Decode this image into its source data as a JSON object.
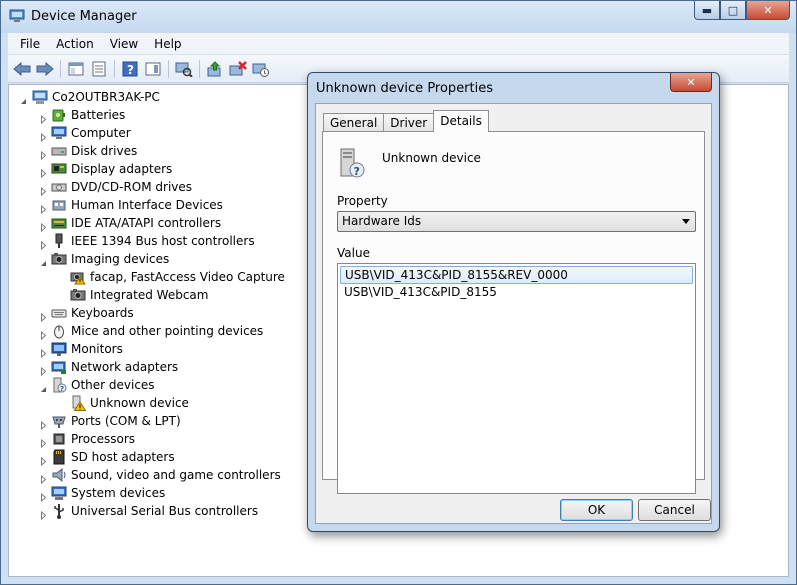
{
  "window": {
    "title": "Device Manager",
    "caption_min": "▬",
    "caption_max": "□",
    "caption_close": "✕"
  },
  "menu": [
    "File",
    "Action",
    "View",
    "Help"
  ],
  "toolbar": {
    "icons": [
      "back-arrow-icon",
      "forward-arrow-icon",
      "console-tree-icon",
      "properties-icon",
      "help-icon",
      "action-pane-icon",
      "scan-hardware-icon",
      "update-driver-icon",
      "uninstall-icon",
      "disable-icon"
    ]
  },
  "tree": {
    "root": "Co2OUTBR3AK-PC",
    "categories": [
      {
        "label": "Batteries",
        "icon": "battery-icon",
        "expanded": false
      },
      {
        "label": "Computer",
        "icon": "computer-icon",
        "expanded": false
      },
      {
        "label": "Disk drives",
        "icon": "disk-drive-icon",
        "expanded": false
      },
      {
        "label": "Display adapters",
        "icon": "display-adapter-icon",
        "expanded": false
      },
      {
        "label": "DVD/CD-ROM drives",
        "icon": "dvd-drive-icon",
        "expanded": false
      },
      {
        "label": "Human Interface Devices",
        "icon": "hid-icon",
        "expanded": false
      },
      {
        "label": "IDE ATA/ATAPI controllers",
        "icon": "ide-controller-icon",
        "expanded": false
      },
      {
        "label": "IEEE 1394 Bus host controllers",
        "icon": "firewire-icon",
        "expanded": false
      },
      {
        "label": "Imaging devices",
        "icon": "camera-icon",
        "expanded": true,
        "children": [
          {
            "label": "facap, FastAccess Video Capture",
            "icon": "camera-warning-icon"
          },
          {
            "label": "Integrated Webcam",
            "icon": "camera-icon"
          }
        ]
      },
      {
        "label": "Keyboards",
        "icon": "keyboard-icon",
        "expanded": false
      },
      {
        "label": "Mice and other pointing devices",
        "icon": "mouse-icon",
        "expanded": false
      },
      {
        "label": "Monitors",
        "icon": "monitor-icon",
        "expanded": false
      },
      {
        "label": "Network adapters",
        "icon": "network-adapter-icon",
        "expanded": false
      },
      {
        "label": "Other devices",
        "icon": "unknown-device-icon",
        "expanded": true,
        "children": [
          {
            "label": "Unknown device",
            "icon": "warning-device-icon"
          }
        ]
      },
      {
        "label": "Ports (COM & LPT)",
        "icon": "port-icon",
        "expanded": false
      },
      {
        "label": "Processors",
        "icon": "processor-icon",
        "expanded": false
      },
      {
        "label": "SD host adapters",
        "icon": "sd-card-icon",
        "expanded": false
      },
      {
        "label": "Sound, video and game controllers",
        "icon": "speaker-icon",
        "expanded": false
      },
      {
        "label": "System devices",
        "icon": "system-device-icon",
        "expanded": false
      },
      {
        "label": "Universal Serial Bus controllers",
        "icon": "usb-icon",
        "expanded": false
      }
    ]
  },
  "dialog": {
    "title": "Unknown device Properties",
    "close": "✕",
    "tabs": [
      {
        "label": "General",
        "active": false
      },
      {
        "label": "Driver",
        "active": false
      },
      {
        "label": "Details",
        "active": true
      }
    ],
    "device_name": "Unknown device",
    "property_label": "Property",
    "property_value": "Hardware Ids",
    "value_label": "Value",
    "values": [
      {
        "text": "USB\\VID_413C&PID_8155&REV_0000",
        "selected": true
      },
      {
        "text": "USB\\VID_413C&PID_8155",
        "selected": false
      }
    ],
    "ok_label": "OK",
    "cancel_label": "Cancel"
  }
}
